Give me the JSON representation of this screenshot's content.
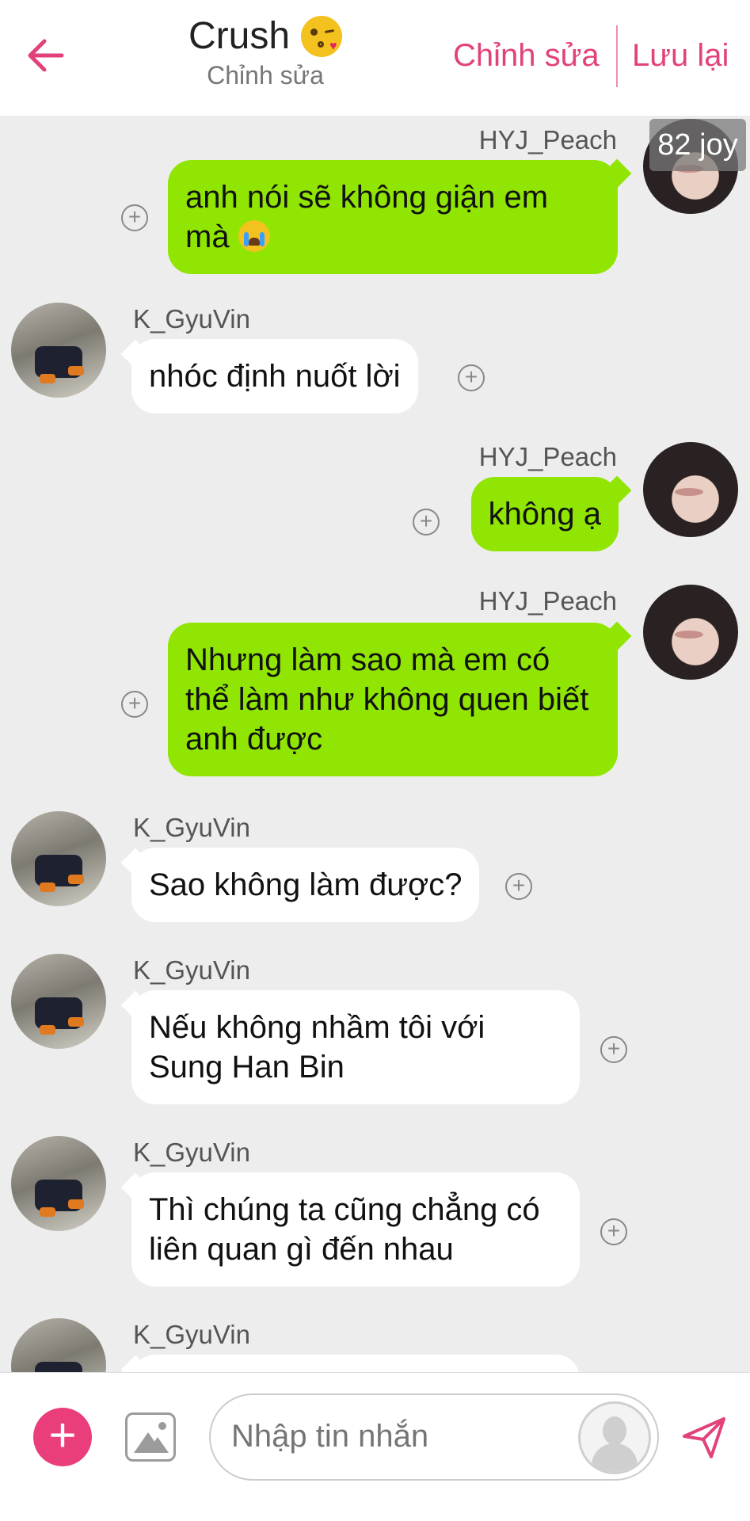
{
  "header": {
    "back_icon": "arrow-left-icon",
    "title": "Crush",
    "title_emoji": "kissing-face-icon",
    "subtitle": "Chỉnh sửa",
    "edit_label": "Chỉnh sửa",
    "save_label": "Lưu lại"
  },
  "overlay_tag": "82 joy",
  "messages": [
    {
      "sender": "HYJ_Peach",
      "side": "right",
      "text": "anh nói sẽ không giận em mà",
      "emoji": "crying-face-icon"
    },
    {
      "sender": "K_GyuVin",
      "side": "left",
      "text": "nhóc định nuốt lời"
    },
    {
      "sender": "HYJ_Peach",
      "side": "right",
      "text": "không ạ"
    },
    {
      "sender": "HYJ_Peach",
      "side": "right",
      "text": "Nhưng làm sao mà em có thể làm như không quen biết anh được"
    },
    {
      "sender": "K_GyuVin",
      "side": "left",
      "text": "Sao không làm được?"
    },
    {
      "sender": "K_GyuVin",
      "side": "left",
      "text": "Nếu không nhầm tôi với Sung Han Bin"
    },
    {
      "sender": "K_GyuVin",
      "side": "left",
      "text": "Thì chúng ta cũng chẳng có liên quan gì đến nhau"
    },
    {
      "sender": "K_GyuVin",
      "side": "left",
      "text": ""
    }
  ],
  "composer": {
    "placeholder": "Nhập tin nhắn",
    "add_icon": "plus-icon",
    "image_icon": "image-icon",
    "avatar_icon": "user-avatar-icon",
    "send_icon": "send-icon"
  },
  "colors": {
    "accent": "#e2427b",
    "self_bubble": "#90e502",
    "other_bubble": "#ffffff",
    "background": "#ededed"
  }
}
